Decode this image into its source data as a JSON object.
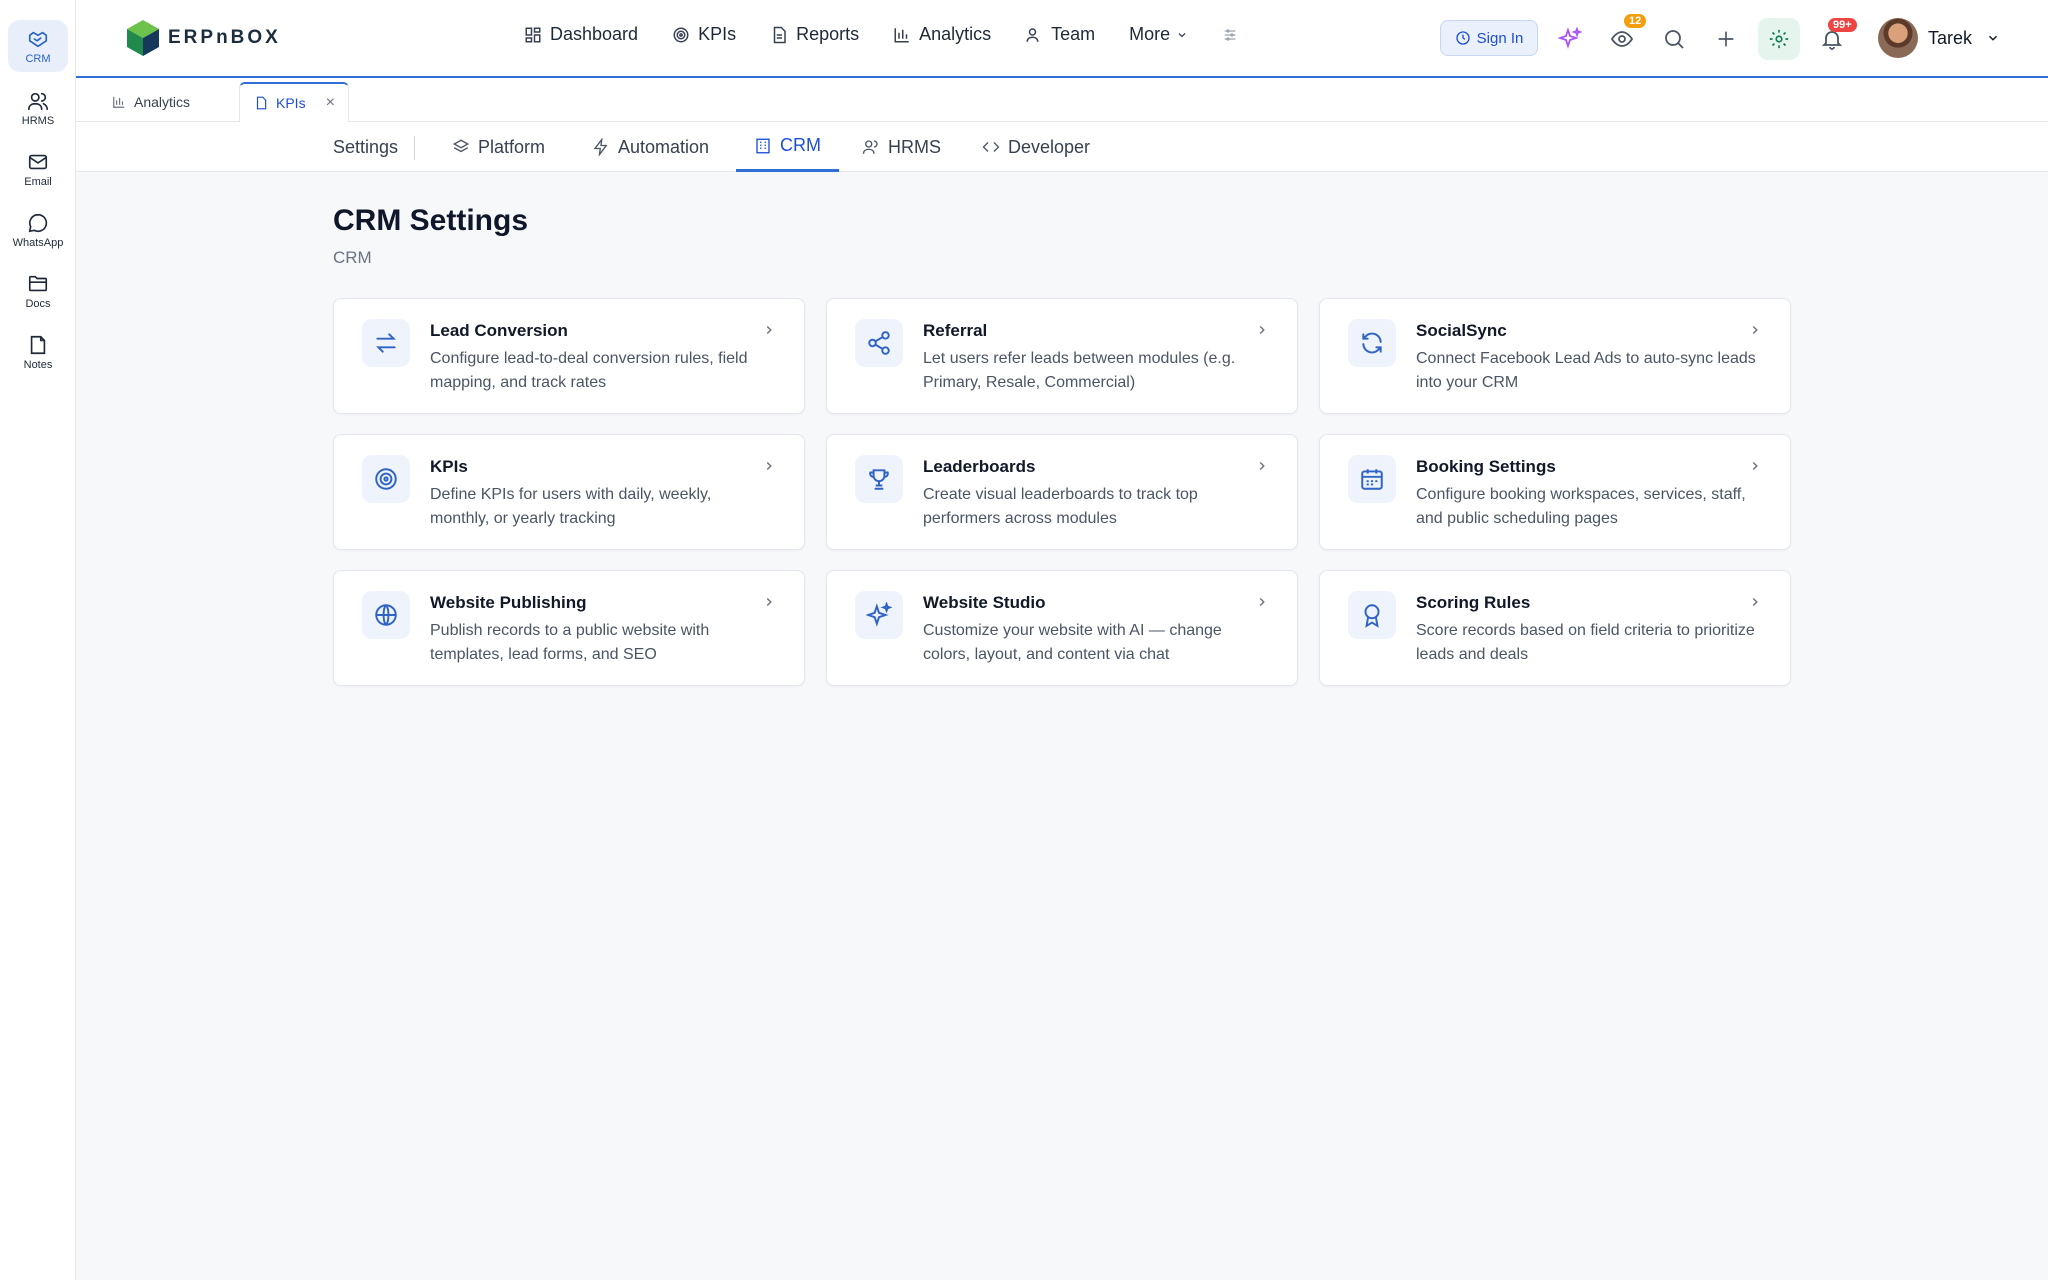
{
  "rail": [
    {
      "label": "CRM",
      "icon": "handshake-icon",
      "active": true
    },
    {
      "label": "HRMS",
      "icon": "users-icon"
    },
    {
      "label": "Email",
      "icon": "mail-icon"
    },
    {
      "label": "WhatsApp",
      "icon": "chat-icon"
    },
    {
      "label": "Docs",
      "icon": "folder-icon"
    },
    {
      "label": "Notes",
      "icon": "note-icon"
    }
  ],
  "brand": {
    "name": "ERPnBOX"
  },
  "nav": [
    {
      "label": "Dashboard",
      "icon": "grid-icon"
    },
    {
      "label": "KPIs",
      "icon": "target-icon"
    },
    {
      "label": "Reports",
      "icon": "document-icon"
    },
    {
      "label": "Analytics",
      "icon": "bar-chart-icon"
    },
    {
      "label": "Team",
      "icon": "user-icon"
    },
    {
      "label": "More",
      "icon": "chevron-down-icon"
    }
  ],
  "header": {
    "signin_label": "Sign In",
    "watch_badge": "12",
    "notif_badge": "99+",
    "user_name": "Tarek"
  },
  "doc_tabs": [
    {
      "label": "Analytics",
      "icon": "bar-chart-icon"
    },
    {
      "label": "KPIs",
      "icon": "document-icon",
      "active": true,
      "close": "×"
    }
  ],
  "settings_tabs": {
    "root": "Settings",
    "items": [
      {
        "label": "Platform",
        "icon": "layers-icon"
      },
      {
        "label": "Automation",
        "icon": "bolt-icon"
      },
      {
        "label": "CRM",
        "icon": "building-icon",
        "active": true
      },
      {
        "label": "HRMS",
        "icon": "users-icon"
      },
      {
        "label": "Developer",
        "icon": "code-icon"
      }
    ]
  },
  "page": {
    "title": "CRM Settings",
    "subtitle": "CRM"
  },
  "cards": [
    {
      "title": "Lead Conversion",
      "desc": "Configure lead-to-deal conversion rules, field mapping, and track rates",
      "icon": "arrows-swap-icon"
    },
    {
      "title": "Referral",
      "desc": "Let users refer leads between modules (e.g. Primary, Resale, Commercial)",
      "icon": "share-icon"
    },
    {
      "title": "SocialSync",
      "desc": "Connect Facebook Lead Ads to auto-sync leads into your CRM",
      "icon": "refresh-icon"
    },
    {
      "title": "KPIs",
      "desc": "Define KPIs for users with daily, weekly, monthly, or yearly tracking",
      "icon": "target-icon"
    },
    {
      "title": "Leaderboards",
      "desc": "Create visual leaderboards to track top performers across modules",
      "icon": "trophy-icon"
    },
    {
      "title": "Booking Settings",
      "desc": "Configure booking workspaces, services, staff, and public scheduling pages",
      "icon": "calendar-icon"
    },
    {
      "title": "Website Publishing",
      "desc": "Publish records to a public website with templates, lead forms, and SEO",
      "icon": "globe-icon"
    },
    {
      "title": "Website Studio",
      "desc": "Customize your website with AI — change colors, layout, and content via chat",
      "icon": "sparkles-icon"
    },
    {
      "title": "Scoring Rules",
      "desc": "Score records based on field criteria to prioritize leads and deals",
      "icon": "award-icon"
    }
  ],
  "colors": {
    "accent": "#2f6fd6",
    "brand_green": "#1f8a4c",
    "badge_orange": "#f59e0b",
    "badge_red": "#ef4444"
  }
}
